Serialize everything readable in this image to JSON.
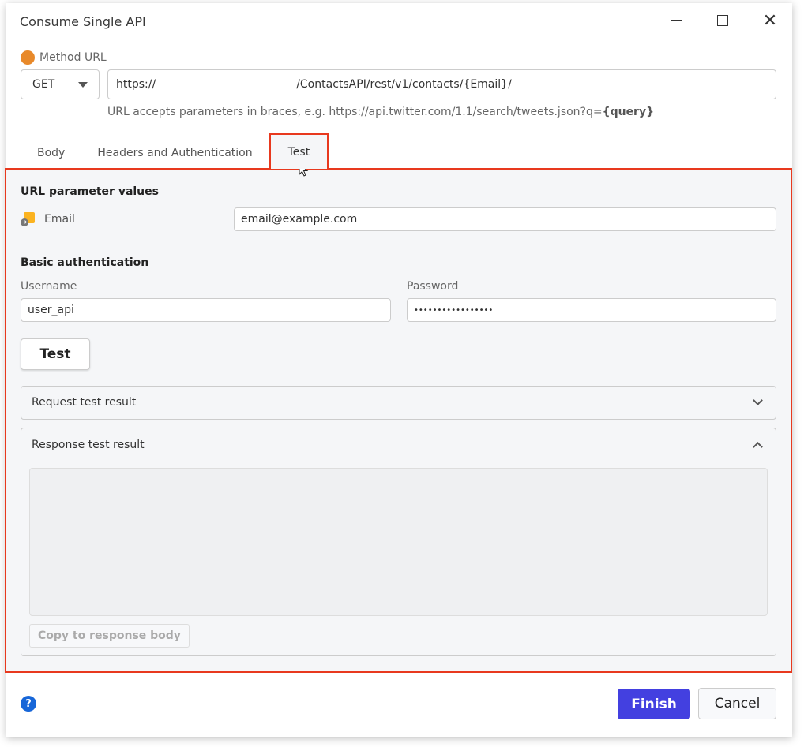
{
  "window": {
    "title": "Consume Single API",
    "controls": {
      "minimize": "minimize-icon",
      "maximize": "maximize-icon",
      "close": "close-icon"
    }
  },
  "method_url": {
    "label": "Method URL",
    "status_color": "#e8892a",
    "method": "GET",
    "url_value": "https://                                        /ContactsAPI/rest/v1/contacts/{Email}/",
    "hint_prefix": "URL accepts parameters in braces, e.g. https://api.twitter.com/1.1/search/tweets.json?q=",
    "hint_param": "{query}"
  },
  "tabs": [
    {
      "label": "Body",
      "active": false
    },
    {
      "label": "Headers and Authentication",
      "active": false
    },
    {
      "label": "Test",
      "active": true
    }
  ],
  "test_panel": {
    "url_params_heading": "URL parameter values",
    "params": [
      {
        "name": "Email",
        "value": "email@example.com"
      }
    ],
    "auth_heading": "Basic authentication",
    "username_label": "Username",
    "username_value": "user_api",
    "password_label": "Password",
    "password_value": "•••••••••••••••••",
    "test_button": "Test",
    "request_result": {
      "label": "Request test result",
      "expanded": false
    },
    "response_result": {
      "label": "Response test result",
      "expanded": true,
      "body": ""
    },
    "copy_button": "Copy to response body"
  },
  "footer": {
    "help": "?",
    "finish": "Finish",
    "cancel": "Cancel",
    "accent_color": "#4340e0",
    "highlight_color": "#e8391e"
  }
}
